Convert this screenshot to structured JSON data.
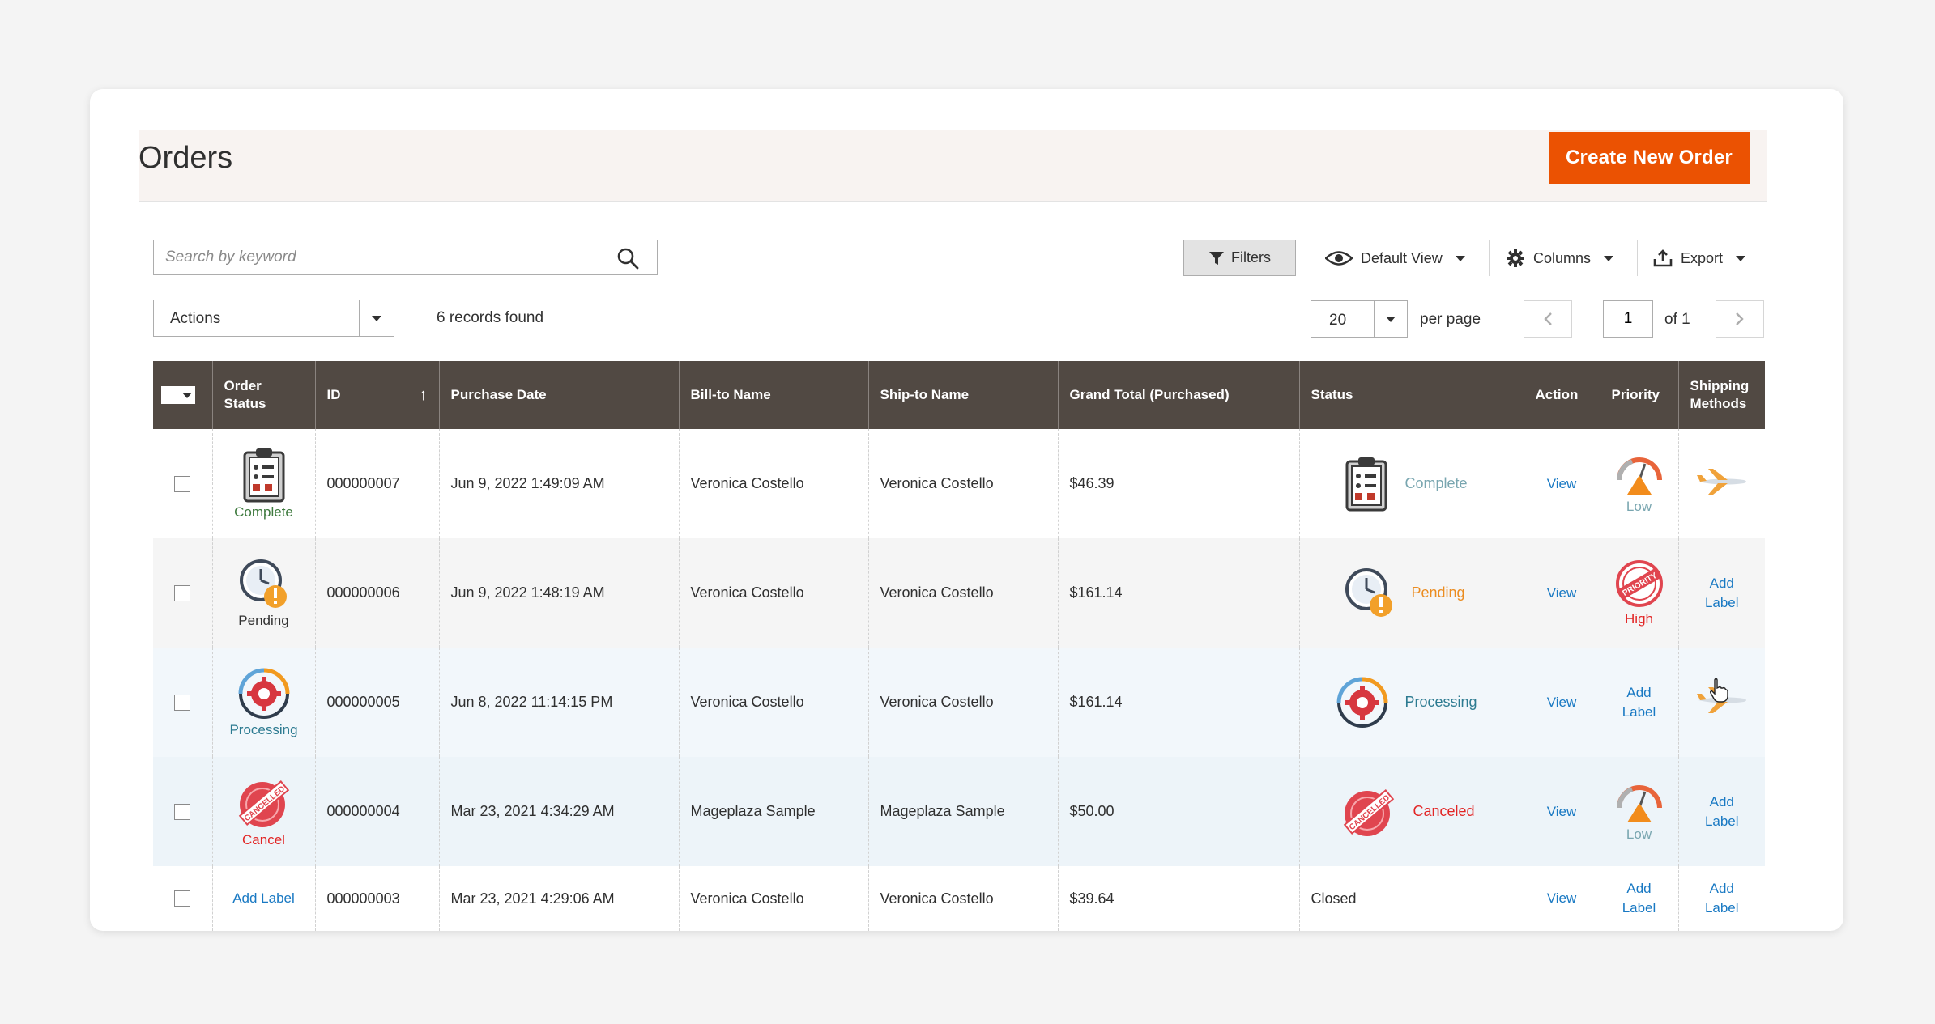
{
  "page": {
    "title": "Orders",
    "create_button": "Create New Order"
  },
  "toolbar": {
    "search_placeholder": "Search by keyword",
    "filters": "Filters",
    "default_view": "Default View",
    "columns": "Columns",
    "export": "Export"
  },
  "actions": {
    "label": "Actions",
    "records_found": "6 records found"
  },
  "pagination": {
    "per_page_value": "20",
    "per_page_label": "per page",
    "current_page": "1",
    "of_label": "of 1"
  },
  "table": {
    "headers": {
      "order_status": "Order Status",
      "id": "ID",
      "purchase_date": "Purchase Date",
      "bill_to": "Bill-to Name",
      "ship_to": "Ship-to Name",
      "grand_total": "Grand Total (Purchased)",
      "status": "Status",
      "action": "Action",
      "priority": "Priority",
      "shipping": "Shipping Methods"
    },
    "rows": [
      {
        "order_status": "Complete",
        "id": "000000007",
        "date": "Jun 9, 2022 1:49:09 AM",
        "bill_to": "Veronica Costello",
        "ship_to": "Veronica Costello",
        "total": "$46.39",
        "status": "Complete",
        "action": "View",
        "priority": "Low",
        "shipping": ""
      },
      {
        "order_status": "Pending",
        "id": "000000006",
        "date": "Jun 9, 2022 1:48:19 AM",
        "bill_to": "Veronica Costello",
        "ship_to": "Veronica Costello",
        "total": "$161.14",
        "status": "Pending",
        "action": "View",
        "priority": "High",
        "shipping": "Add Label"
      },
      {
        "order_status": "Processing",
        "id": "000000005",
        "date": "Jun 8, 2022 11:14:15 PM",
        "bill_to": "Veronica Costello",
        "ship_to": "Veronica Costello",
        "total": "$161.14",
        "status": "Processing",
        "action": "View",
        "priority": "Add Label",
        "shipping": ""
      },
      {
        "order_status": "Cancel",
        "id": "000000004",
        "date": "Mar 23, 2021 4:34:29 AM",
        "bill_to": "Mageplaza Sample",
        "ship_to": "Mageplaza Sample",
        "total": "$50.00",
        "status": "Canceled",
        "action": "View",
        "priority": "Low",
        "shipping": "Add Label"
      },
      {
        "order_status": "Add Label",
        "id": "000000003",
        "date": "Mar 23, 2021 4:29:06 AM",
        "bill_to": "Veronica Costello",
        "ship_to": "Veronica Costello",
        "total": "$39.64",
        "status": "Closed",
        "action": "View",
        "priority": "Add Label",
        "shipping": "Add Label"
      }
    ]
  },
  "badges": {
    "cancelled_stamp": "CANCELLED",
    "priority_stamp": "PRIORITY"
  },
  "colors": {
    "accent": "#eb5202",
    "header_bg": "#514943",
    "link": "#1979c3"
  }
}
